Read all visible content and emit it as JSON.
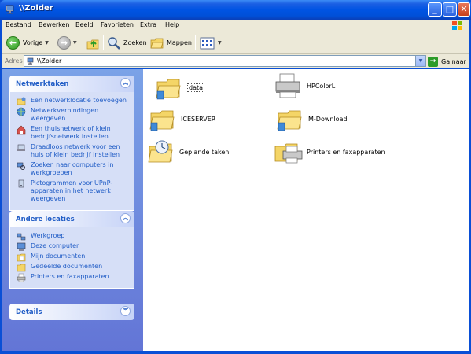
{
  "window": {
    "title": "\\\\Zolder"
  },
  "menu": [
    "Bestand",
    "Bewerken",
    "Beeld",
    "Favorieten",
    "Extra",
    "Help"
  ],
  "toolbar": {
    "back_label": "Vorige",
    "search_label": "Zoeken",
    "folders_label": "Mappen"
  },
  "address": {
    "label": "Adres",
    "value": "\\\\Zolder",
    "go_label": "Ga naar"
  },
  "panels": {
    "network_tasks": {
      "title": "Netwerktaken",
      "items": [
        "Een netwerklocatie toevoegen",
        "Netwerkverbindingen weergeven",
        "Een thuisnetwerk of klein bedrijfsnetwerk instellen",
        "Draadloos netwerk voor een huis of klein bedrijf instellen",
        "Zoeken naar computers in werkgroepen",
        "Pictogrammen voor UPnP-apparaten in het netwerk weergeven"
      ]
    },
    "other_places": {
      "title": "Andere locaties",
      "items": [
        "Werkgroep",
        "Deze computer",
        "Mijn documenten",
        "Gedeelde documenten",
        "Printers en faxapparaten"
      ]
    },
    "details": {
      "title": "Details"
    }
  },
  "items": [
    {
      "label": "data",
      "type": "share"
    },
    {
      "label": "HPColorL",
      "type": "printer"
    },
    {
      "label": "ICESERVER",
      "type": "share"
    },
    {
      "label": "M-Download",
      "type": "share"
    },
    {
      "label": "Geplande taken",
      "type": "scheduled"
    },
    {
      "label": "Printers en faxapparaten",
      "type": "printers"
    }
  ]
}
